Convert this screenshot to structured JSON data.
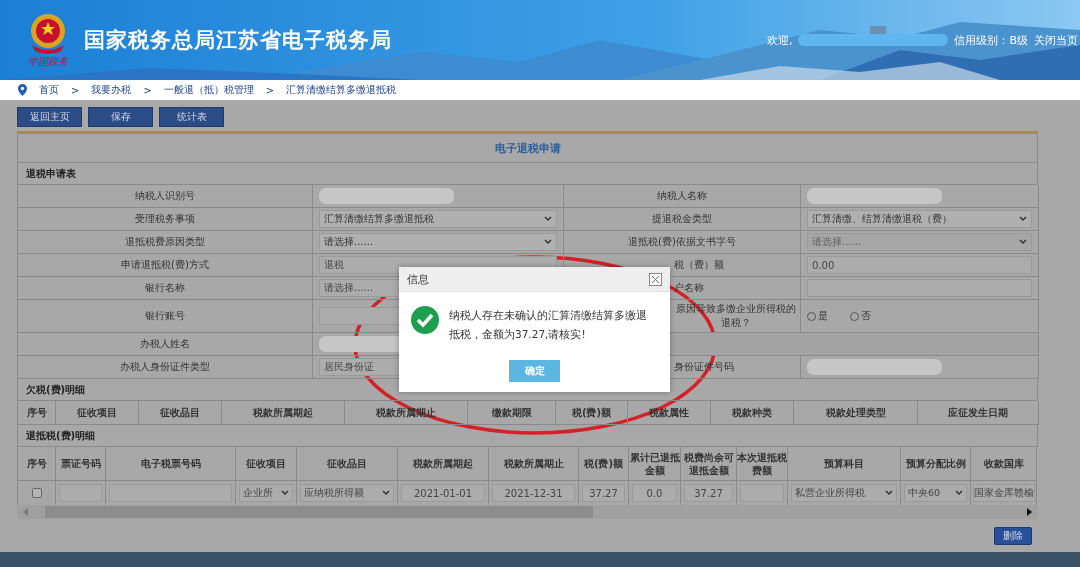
{
  "header": {
    "title": "国家税务总局江苏省电子税务局",
    "logo_text": "中国税务",
    "welcome": "欢迎,",
    "credit": "信用级别：B级",
    "close": "关闭当页"
  },
  "breadcrumb": [
    {
      "label": "首页"
    },
    {
      "separator": ">",
      "label": "我要办税"
    },
    {
      "separator": ">",
      "label": "一般退（抵）税管理"
    },
    {
      "separator": ">",
      "label": "汇算清缴结算多缴退抵税"
    }
  ],
  "toolbar": [
    "返回主页",
    "保存",
    "统计表"
  ],
  "panel": {
    "title": "电子退税申请",
    "section": "退税申请表",
    "rows": [
      {
        "cells": [
          {
            "kind": "label",
            "text": "纳税人识别号"
          },
          {
            "kind": "blurred"
          },
          {
            "kind": "label",
            "text": "纳税人名称"
          },
          {
            "kind": "blurred"
          }
        ]
      },
      {
        "cells": [
          {
            "kind": "label",
            "text": "受理税务事项"
          },
          {
            "kind": "select",
            "value": "汇算清缴结算多缴退抵税",
            "disabled": false
          },
          {
            "kind": "label",
            "text": "提退税金类型"
          },
          {
            "kind": "select",
            "value": "汇算清缴、结算清缴退税（费）",
            "disabled": false
          }
        ]
      },
      {
        "cells": [
          {
            "kind": "label",
            "text": "退抵税费原因类型"
          },
          {
            "kind": "select",
            "value": "请选择......",
            "disabled": false
          },
          {
            "kind": "label",
            "text": "退抵税(费)依据文书字号"
          },
          {
            "kind": "select",
            "value": "请选择......",
            "disabled": true
          }
        ]
      },
      {
        "cells": [
          {
            "kind": "label",
            "text": "申请退抵税(费)方式"
          },
          {
            "kind": "text",
            "value": "退税"
          },
          {
            "kind": "covered_label",
            "text": "税（费）额"
          },
          {
            "kind": "text",
            "value": "0.00"
          }
        ]
      },
      {
        "cells": [
          {
            "kind": "label",
            "text": "银行名称"
          },
          {
            "kind": "text",
            "value": "请选择......"
          },
          {
            "kind": "covered_label",
            "text": "户名称"
          },
          {
            "kind": "text"
          }
        ]
      },
      {
        "cells": [
          {
            "kind": "label",
            "text": "银行账号"
          },
          {
            "kind": "text"
          },
          {
            "kind": "covered_label",
            "text": "原因导致多缴企业所得税的退税？"
          },
          {
            "kind": "radio",
            "options": [
              {
                "label": "是",
                "selected": false
              },
              {
                "label": "否",
                "selected": false
              }
            ]
          }
        ]
      },
      {
        "cells": [
          {
            "kind": "label",
            "text": "办税人姓名"
          },
          {
            "kind": "blurred"
          },
          {
            "kind": "empty"
          }
        ]
      },
      {
        "cells": [
          {
            "kind": "label",
            "text": "办税人身份证件类型"
          },
          {
            "kind": "text",
            "value": "居民身份证"
          },
          {
            "kind": "covered_label",
            "text": "身份证件号码"
          },
          {
            "kind": "blurred"
          }
        ]
      }
    ]
  },
  "arrears": {
    "title": "欠税(费)明细",
    "columns": [
      "序号",
      "征收项目",
      "征收品目",
      "税款所属期起",
      "税款所属期止",
      "缴款期限",
      "税(费)额",
      "税款属性",
      "税款种类",
      "税款处理类型",
      "应征发生日期"
    ]
  },
  "refunds": {
    "title": "退抵税(费)明细",
    "columns": [
      "序号",
      "票证号码",
      "电子税票号码",
      "征收项目",
      "征收品目",
      "税款所属期起",
      "税款所属期止",
      "税(费)额",
      "累计已退抵金额",
      "税费尚余可退抵金额",
      "本次退抵税费额",
      "预算科目",
      "预算分配比例",
      "收款国库"
    ],
    "rows": [
      {
        "cells": [
          {
            "kind": "checkbox",
            "checked": false
          },
          {
            "kind": "input"
          },
          {
            "kind": "input"
          },
          {
            "kind": "select",
            "value": "企业所"
          },
          {
            "kind": "select",
            "value": "应纳税所得额"
          },
          {
            "kind": "input",
            "value": "2021-01-01"
          },
          {
            "kind": "input",
            "value": "2021-12-31"
          },
          {
            "kind": "input",
            "value": "37.27"
          },
          {
            "kind": "input",
            "value": "0.0"
          },
          {
            "kind": "input",
            "value": "37.27"
          },
          {
            "kind": "input"
          },
          {
            "kind": "select",
            "value": "私营企业所得税"
          },
          {
            "kind": "select",
            "value": "中央60"
          },
          {
            "kind": "text",
            "value": "国家金库赣榆"
          }
        ]
      }
    ],
    "delete": "删除"
  },
  "dialog": {
    "title": "信息",
    "message": "纳税人存在未确认的汇算清缴结算多缴退抵税，金额为37.27,请核实!",
    "ok": "确定"
  }
}
